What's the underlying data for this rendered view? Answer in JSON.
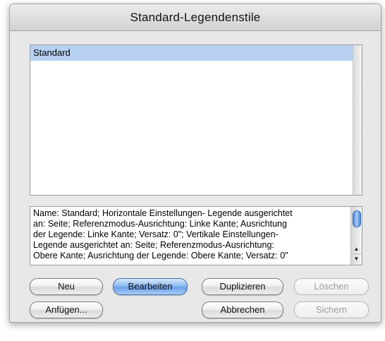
{
  "window": {
    "title": "Standard-Legendenstile"
  },
  "list": {
    "items": [
      {
        "label": "Standard",
        "selected": true
      }
    ]
  },
  "description": {
    "lines": [
      "Name: Standard; Horizontale Einstellungen- Legende ausgerichtet",
      "an: Seite; Referenzmodus-Ausrichtung: Linke Kante; Ausrichtung",
      "der Legende: Linke Kante; Versatz: 0\"; Vertikale Einstellungen-",
      "Legende ausgerichtet an: Seite; Referenzmodus-Ausrichtung:",
      "Obere Kante; Ausrichtung der Legende: Obere Kante; Versatz: 0\""
    ]
  },
  "buttons": {
    "new": "Neu",
    "edit": "Bearbeiten",
    "duplicate": "Duplizieren",
    "delete": "Löschen",
    "append": "Anfügen...",
    "cancel": "Abbrechen",
    "save": "Sichern"
  },
  "colors": {
    "selection": "#b8d1f2",
    "default_button": "#6aa2ea",
    "disabled_text": "#9c9c9c"
  }
}
